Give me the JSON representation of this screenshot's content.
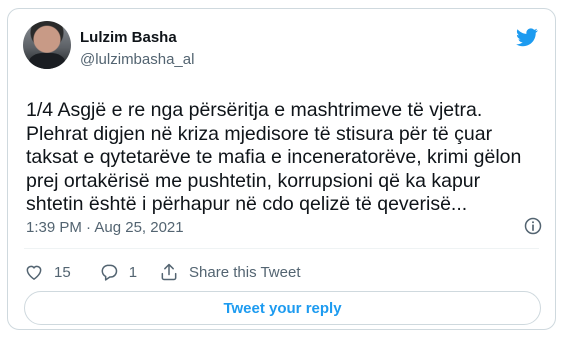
{
  "author": {
    "name": "Lulzim Basha",
    "handle": "@lulzimbasha_al"
  },
  "tweet": {
    "text": "1/4 Asgjë e re nga përsëritja e mashtrimeve të vjetra.\nPlehrat digjen në kriza mjedisore të stisura për të çuar\ntaksat e qytetarëve te mafia e inceneratorëve, krimi gëlon\nprej ortakërisë me pushtetin, korrupsioni që ka kapur\nshtetin është i përhapur në cdo qelizë të qeverisë...",
    "timestamp": "1:39 PM · Aug 25, 2021"
  },
  "actions": {
    "likes": "15",
    "replies": "1",
    "share_label": "Share this Tweet"
  },
  "reply_button_label": "Tweet your reply",
  "colors": {
    "accent": "#1d9bf0",
    "text": "#0f1419",
    "muted": "#536471",
    "border": "#cfd9de"
  },
  "icons": [
    "twitter-bird-icon",
    "info-icon",
    "heart-icon",
    "reply-icon",
    "share-icon"
  ]
}
